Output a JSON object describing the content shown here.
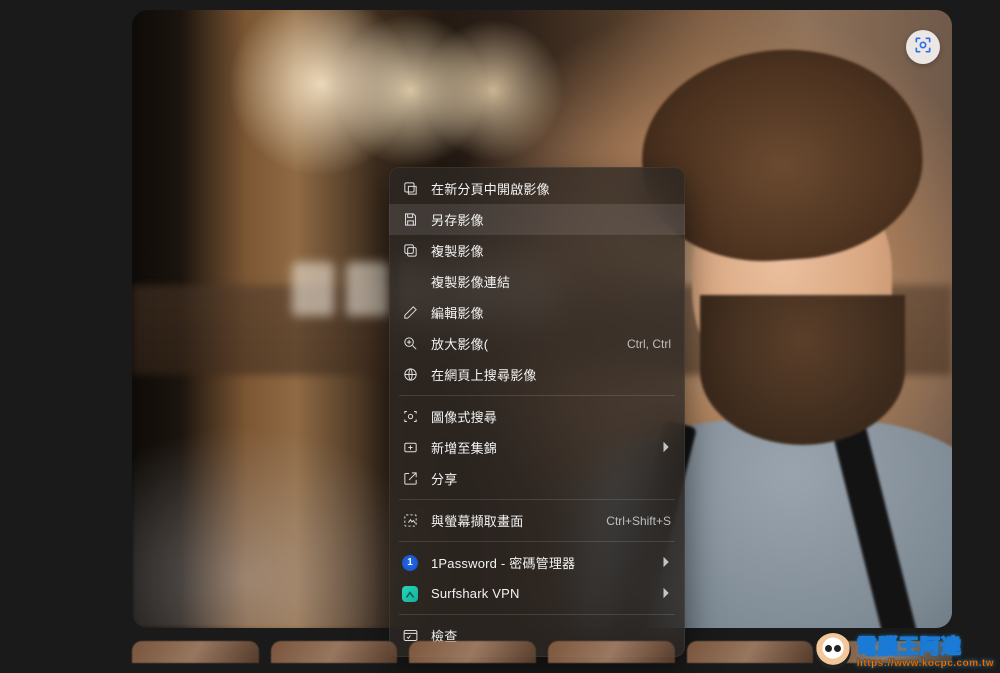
{
  "visual_search_button": {
    "name": "visual-search"
  },
  "context_menu": {
    "items": [
      {
        "id": "open-new-tab",
        "label": "在新分頁中開啟影像",
        "icon": "open-in-new"
      },
      {
        "id": "save-image",
        "label": "另存影像",
        "icon": "save",
        "highlighted": true
      },
      {
        "id": "copy-image",
        "label": "複製影像",
        "icon": "copy-image"
      },
      {
        "id": "copy-link",
        "label": "複製影像連結",
        "icon": ""
      },
      {
        "id": "edit-image",
        "label": "編輯影像",
        "icon": "edit"
      },
      {
        "id": "zoom-image",
        "label": "放大影像(",
        "icon": "zoom",
        "accelerator": "Ctrl, Ctrl"
      },
      {
        "id": "search-web",
        "label": "在網頁上搜尋影像",
        "icon": "search-web"
      },
      {
        "sep": true
      },
      {
        "id": "visual-search",
        "label": "圖像式搜尋",
        "icon": "scan"
      },
      {
        "id": "add-collection",
        "label": "新增至集錦",
        "icon": "collections",
        "submenu": true
      },
      {
        "id": "share",
        "label": "分享",
        "icon": "share"
      },
      {
        "sep": true
      },
      {
        "id": "screenshot",
        "label": "與螢幕擷取畫面",
        "icon": "snip",
        "accelerator": "Ctrl+Shift+S"
      },
      {
        "sep": true
      },
      {
        "id": "ext-1password",
        "label": "1Password - 密碼管理器",
        "icon": "brand-1password",
        "submenu": true
      },
      {
        "id": "ext-surfshark",
        "label": "Surfshark VPN",
        "icon": "brand-surfshark",
        "submenu": true
      },
      {
        "sep": true
      },
      {
        "id": "inspect",
        "label": "檢查",
        "icon": "inspect"
      }
    ]
  },
  "watermark": {
    "title": "電腦王阿達",
    "url": "https://www.kocpc.com.tw"
  }
}
